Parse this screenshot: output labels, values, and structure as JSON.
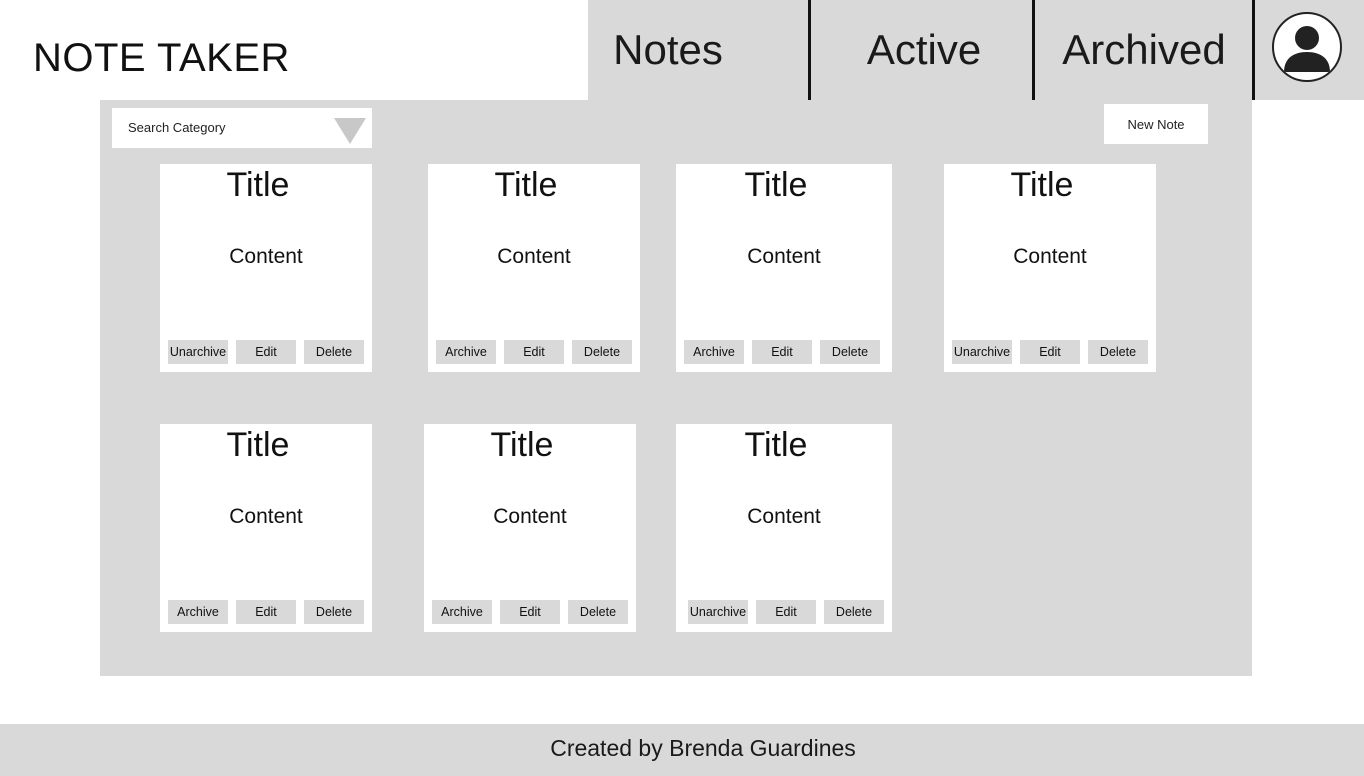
{
  "app": {
    "title": "NOTE TAKER"
  },
  "nav": {
    "tabs": [
      {
        "label": "Notes"
      },
      {
        "label": "Active"
      },
      {
        "label": "Archived"
      }
    ],
    "avatar_icon": "user-avatar-icon"
  },
  "toolbar": {
    "search_placeholder": "Search Category",
    "dropdown_icon": "triangle-down-icon",
    "new_note_label": "New Note"
  },
  "notes": [
    {
      "title": "Title",
      "content": "Content",
      "toggle_label": "Unarchive",
      "edit_label": "Edit",
      "delete_label": "Delete"
    },
    {
      "title": "Title",
      "content": "Content",
      "toggle_label": "Archive",
      "edit_label": "Edit",
      "delete_label": "Delete"
    },
    {
      "title": "Title",
      "content": "Content",
      "toggle_label": "Archive",
      "edit_label": "Edit",
      "delete_label": "Delete"
    },
    {
      "title": "Title",
      "content": "Content",
      "toggle_label": "Unarchive",
      "edit_label": "Edit",
      "delete_label": "Delete"
    },
    {
      "title": "Title",
      "content": "Content",
      "toggle_label": "Archive",
      "edit_label": "Edit",
      "delete_label": "Delete"
    },
    {
      "title": "Title",
      "content": "Content",
      "toggle_label": "Archive",
      "edit_label": "Edit",
      "delete_label": "Delete"
    },
    {
      "title": "Title",
      "content": "Content",
      "toggle_label": "Unarchive",
      "edit_label": "Edit",
      "delete_label": "Delete"
    }
  ],
  "footer": {
    "text": "Created by Brenda Guardines"
  },
  "colors": {
    "panel": "#d9d9d9",
    "card": "#ffffff",
    "text": "#111111"
  }
}
